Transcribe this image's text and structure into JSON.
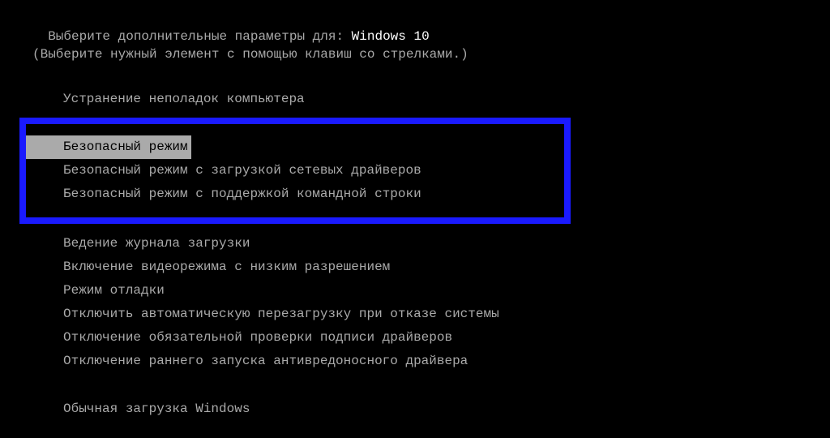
{
  "header": {
    "prompt_prefix": "Выберите дополнительные параметры для: ",
    "os_name": "Windows 10",
    "instruction": "(Выберите нужный элемент с помощью клавиш со стрелками.)"
  },
  "group1": {
    "item0": "Устранение неполадок компьютера"
  },
  "safe_mode_box": {
    "item0": "Безопасный режим",
    "item1": "Безопасный режим с загрузкой сетевых драйверов",
    "item2": "Безопасный режим с поддержкой командной строки"
  },
  "group3": {
    "item0": "Ведение журнала загрузки",
    "item1": "Включение видеорежима с низким разрешением",
    "item2": "Режим отладки",
    "item3": "Отключить автоматическую перезагрузку при отказе системы",
    "item4": "Отключение обязательной проверки подписи драйверов",
    "item5": "Отключение раннего запуска антивредоносного драйвера"
  },
  "group4": {
    "item0": "Обычная загрузка Windows"
  }
}
